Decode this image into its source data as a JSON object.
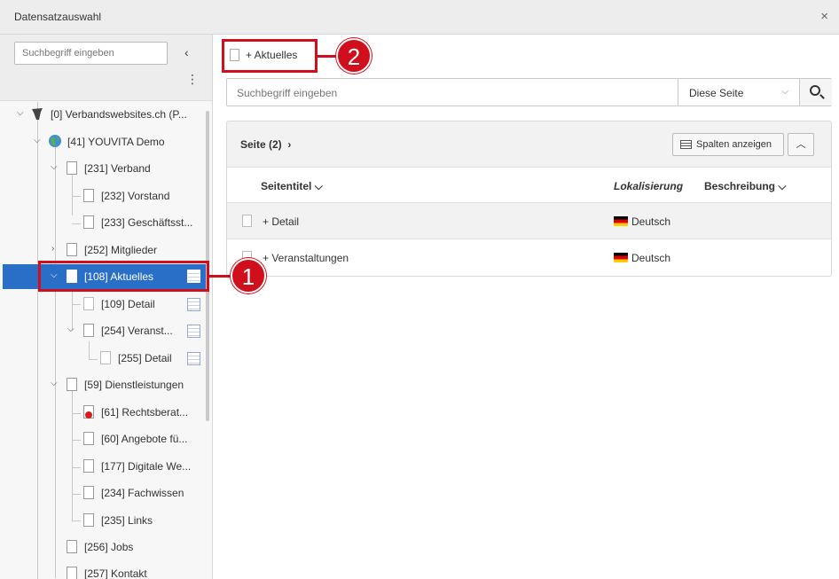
{
  "window": {
    "title": "Datensatzauswahl",
    "close_label": "×"
  },
  "tree_panel": {
    "search_placeholder": "Suchbegriff eingeben",
    "collapse_icon": "‹",
    "menu_icon": "⋮",
    "nodes": [
      {
        "label": "[0] Verbandswebsites.ch (P...",
        "icon": "typo3-logo-icon",
        "expanded": true
      },
      {
        "label": "[41] YOUVITA Demo",
        "icon": "globe-icon",
        "expanded": true
      },
      {
        "label": "[231] Verband",
        "icon": "page-icon",
        "expanded": true
      },
      {
        "label": "[232] Vorstand",
        "icon": "page-icon"
      },
      {
        "label": "[233] Geschäftsst...",
        "icon": "page-icon"
      },
      {
        "label": "[252] Mitglieder",
        "icon": "page-icon",
        "expanded": false
      },
      {
        "label": "[108] Aktuelles",
        "icon": "page-icon",
        "expanded": true,
        "selected": true
      },
      {
        "label": "[109] Detail",
        "icon": "page-icon"
      },
      {
        "label": "[254] Veranst...",
        "icon": "page-icon",
        "expanded": true
      },
      {
        "label": "[255] Detail",
        "icon": "page-icon"
      },
      {
        "label": "[59] Dienstleistungen",
        "icon": "page-icon",
        "expanded": true
      },
      {
        "label": "[61] Rechtsberat...",
        "icon": "page-restricted-icon"
      },
      {
        "label": "[60] Angebote fü...",
        "icon": "page-icon"
      },
      {
        "label": "[177] Digitale We...",
        "icon": "page-icon"
      },
      {
        "label": "[234] Fachwissen",
        "icon": "page-icon"
      },
      {
        "label": "[235] Links",
        "icon": "page-icon"
      },
      {
        "label": "[256] Jobs",
        "icon": "page-icon"
      },
      {
        "label": "[257] Kontakt",
        "icon": "page-icon"
      }
    ]
  },
  "annotations": {
    "badge_1": "1",
    "badge_2": "2"
  },
  "record_list": {
    "breadcrumb_label": "+ Aktuelles",
    "search_placeholder": "Suchbegriff eingeben",
    "scope_select": "Diese Seite",
    "panel_title": "Seite (2)",
    "show_columns_label": "Spalten anzeigen",
    "columns": [
      "Seitentitel",
      "Lokalisierung",
      "Beschreibung"
    ],
    "rows": [
      {
        "title": "+ Detail",
        "language": "Deutsch"
      },
      {
        "title": "+ Veranstaltungen",
        "language": "Deutsch"
      }
    ]
  }
}
